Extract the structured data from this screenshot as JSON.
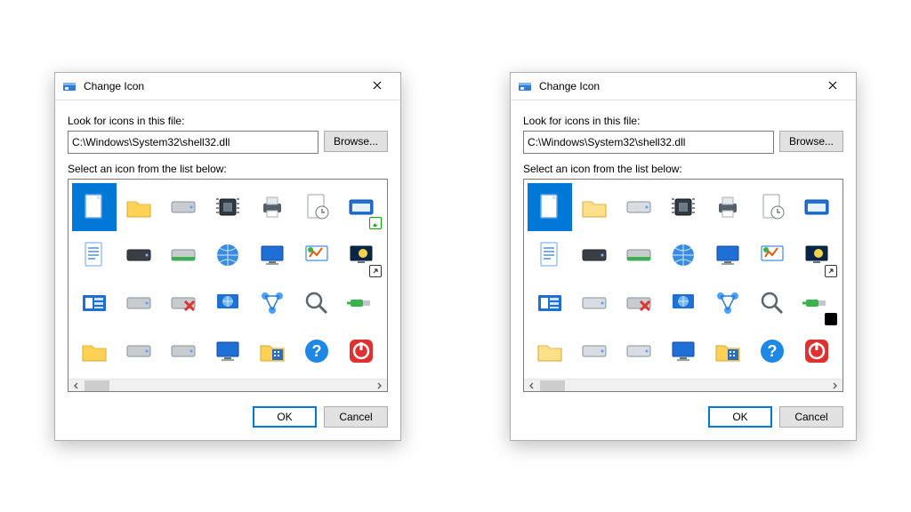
{
  "dialogs": [
    {
      "id": "left",
      "title": "Change Icon",
      "path_label": "Look for icons in this file:",
      "path_value": "C:\\Windows\\System32\\shell32.dll",
      "browse_label": "Browse...",
      "select_label": "Select an icon from the list below:",
      "ok_label": "OK",
      "cancel_label": "Cancel",
      "style": "flat",
      "icons": [
        {
          "name": "file-blank",
          "selected": true
        },
        {
          "name": "folder"
        },
        {
          "name": "drive"
        },
        {
          "name": "chip"
        },
        {
          "name": "printer"
        },
        {
          "name": "file-clock"
        },
        {
          "name": "window-run",
          "badge": "share"
        },
        {
          "name": "file-text"
        },
        {
          "name": "drive-dark"
        },
        {
          "name": "drive-green"
        },
        {
          "name": "globe"
        },
        {
          "name": "monitor"
        },
        {
          "name": "chart-monitor"
        },
        {
          "name": "monitor-night",
          "badge": "shortcut"
        },
        {
          "name": "window-list"
        },
        {
          "name": "drive-light"
        },
        {
          "name": "drive-x"
        },
        {
          "name": "globe-monitor"
        },
        {
          "name": "network"
        },
        {
          "name": "magnifier"
        },
        {
          "name": "usb"
        },
        {
          "name": "folder-alt"
        },
        {
          "name": "drive-alt"
        },
        {
          "name": "drive-alt2"
        },
        {
          "name": "monitor-blank"
        },
        {
          "name": "folder-grid"
        },
        {
          "name": "help"
        },
        {
          "name": "power"
        }
      ]
    },
    {
      "id": "right",
      "title": "Change Icon",
      "path_label": "Look for icons in this file:",
      "path_value": "C:\\Windows\\System32\\shell32.dll",
      "browse_label": "Browse...",
      "select_label": "Select an icon from the list below:",
      "ok_label": "OK",
      "cancel_label": "Cancel",
      "style": "glossy",
      "icons": [
        {
          "name": "file-blank",
          "selected": true
        },
        {
          "name": "folder"
        },
        {
          "name": "drive"
        },
        {
          "name": "chip"
        },
        {
          "name": "printer"
        },
        {
          "name": "file-clock"
        },
        {
          "name": "window-run"
        },
        {
          "name": "file-text"
        },
        {
          "name": "drive-dark"
        },
        {
          "name": "drive-green"
        },
        {
          "name": "globe"
        },
        {
          "name": "monitor"
        },
        {
          "name": "chart-monitor"
        },
        {
          "name": "monitor-night",
          "badge": "shortcut"
        },
        {
          "name": "window-list"
        },
        {
          "name": "drive-light"
        },
        {
          "name": "drive-x"
        },
        {
          "name": "globe-monitor"
        },
        {
          "name": "network"
        },
        {
          "name": "magnifier"
        },
        {
          "name": "usb",
          "badge": "black"
        },
        {
          "name": "folder-alt"
        },
        {
          "name": "drive-alt"
        },
        {
          "name": "drive-alt2"
        },
        {
          "name": "monitor-blank"
        },
        {
          "name": "folder-grid"
        },
        {
          "name": "help"
        },
        {
          "name": "power"
        }
      ]
    }
  ]
}
